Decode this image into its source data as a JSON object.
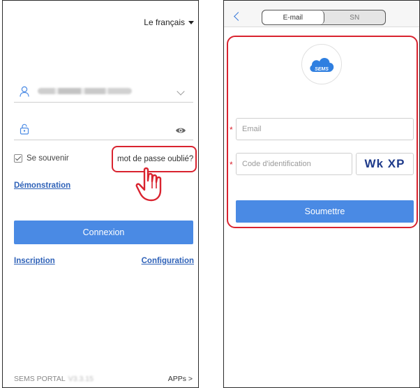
{
  "left": {
    "language": "Le français",
    "remember_label": "Se souvenir",
    "forgot_label": "mot de passe oublié?",
    "demo_label": "Démonstration",
    "login_label": "Connexion",
    "register_label": "Inscription",
    "config_label": "Configuration",
    "footer_brand": "SEMS PORTAL",
    "footer_version": "V3.3.15",
    "apps_label": "APPs >"
  },
  "right": {
    "tabs": [
      {
        "label": "E-mail",
        "active": true
      },
      {
        "label": "SN",
        "active": false
      }
    ],
    "logo_text": "SEMS",
    "email_placeholder": "Email",
    "code_placeholder": "Code d'identification",
    "captcha": "Wk XP",
    "required_mark": "*",
    "submit_label": "Soumettre"
  },
  "colors": {
    "accent": "#4a8ae4",
    "link": "#2f62b8",
    "highlight": "#d9232f",
    "captcha": "#1e3a8a"
  },
  "icons": [
    "user-icon",
    "lock-icon",
    "chevron-down-icon",
    "eye-icon",
    "pointing-hand-icon",
    "back-arrow-icon",
    "cloud-logo-icon"
  ]
}
